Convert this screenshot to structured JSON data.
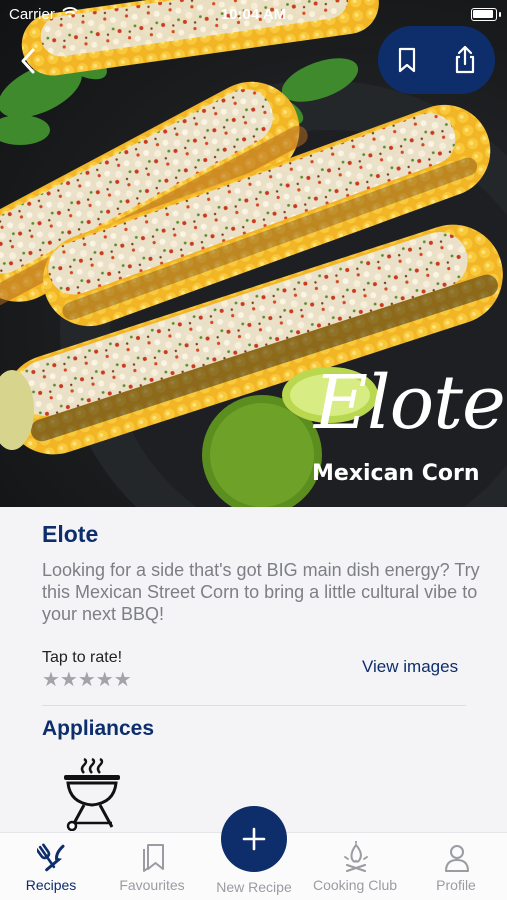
{
  "status_bar": {
    "carrier": "Carrier",
    "time": "10:04 AM"
  },
  "hero": {
    "overlay_title": "Elote",
    "overlay_subtitle": "Mexican Corn"
  },
  "recipe": {
    "title": "Elote",
    "description": "Looking for a side that's got BIG main dish energy? Try this Mexican Street Corn to bring a little cultural vibe to your next BBQ!",
    "rate_label": "Tap to rate!",
    "stars": "★★★★★",
    "rating": 0,
    "view_images": "View images"
  },
  "appliances": {
    "heading": "Appliances",
    "items": [
      {
        "icon": "grill-icon"
      }
    ]
  },
  "tabbar": {
    "tabs": [
      {
        "label": "Recipes",
        "icon": "fork-knife-icon",
        "active": true
      },
      {
        "label": "Favourites",
        "icon": "bookmarks-icon",
        "active": false
      },
      {
        "label": "New Recipe",
        "icon": "plus-icon",
        "active": false
      },
      {
        "label": "Cooking Club",
        "icon": "campfire-icon",
        "active": false
      },
      {
        "label": "Profile",
        "icon": "person-icon",
        "active": false
      }
    ]
  },
  "colors": {
    "brand": "#0d2e6b",
    "muted_text": "#7d7f85",
    "background": "#f4f4f7"
  }
}
